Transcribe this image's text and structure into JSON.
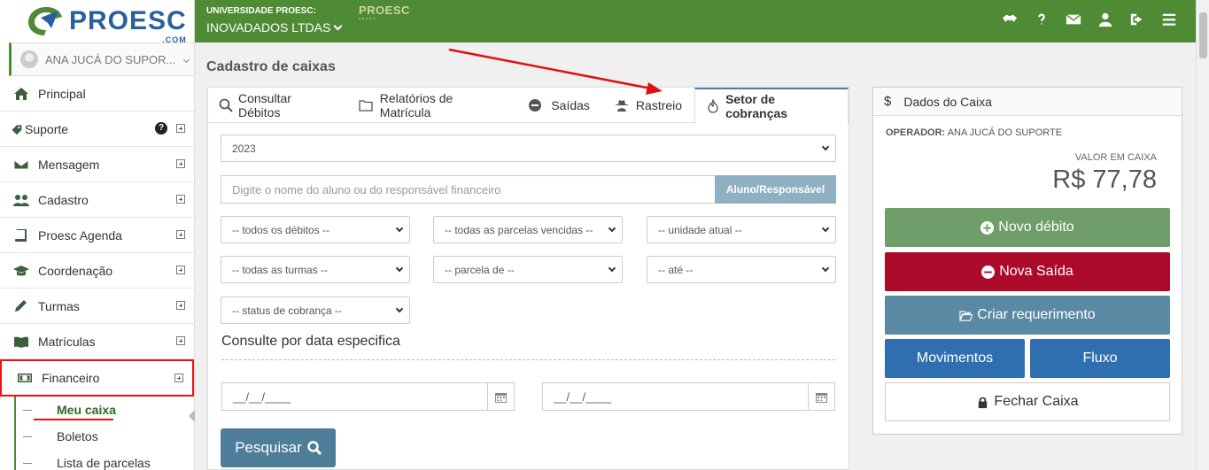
{
  "header": {
    "org": "UNIVERSIDADE PROESC:",
    "unit": "INOVADADOS LTDAS",
    "brand": "PROESC",
    "logo_com": ".COM"
  },
  "sidebar": {
    "user": "ANA JUCÁ DO SUPOR...",
    "items": [
      {
        "label": "Principal"
      },
      {
        "label": "Suporte"
      },
      {
        "label": "Mensagem"
      },
      {
        "label": "Cadastro"
      },
      {
        "label": "Proesc Agenda"
      },
      {
        "label": "Coordenação"
      },
      {
        "label": "Turmas"
      },
      {
        "label": "Matrículas"
      },
      {
        "label": "Financeiro"
      }
    ],
    "sub": [
      "Meu caixa",
      "Boletos",
      "Lista de parcelas"
    ],
    "help_mark": "?"
  },
  "page": {
    "title": "Cadastro de caixas"
  },
  "tabs": [
    "Consultar Débitos",
    "Relatórios de Matrícula",
    "Saídas",
    "Rastreio",
    "Setor de cobranças"
  ],
  "filters": {
    "year": "2023",
    "search_placeholder": "Digite o nome do aluno ou do responsável financeiro",
    "search_button": "Aluno/Responsável",
    "debts": "-- todos os débitos --",
    "installments": "-- todas as parcelas vencidas --",
    "unit": "-- unidade atual --",
    "classes": "-- todas as turmas --",
    "from_parcel": "-- parcela de --",
    "to": "-- até --",
    "status": "-- status de cobrança --",
    "date_section": "Consulte por data especifica",
    "date_from": "__/__/____",
    "date_to": "__/__/____",
    "submit": "Pesquisar"
  },
  "cashbox": {
    "title": "Dados do Caixa",
    "currency_symbol": "$",
    "operator_label": "OPERADOR:",
    "operator": "ANA JUCÁ DO SUPORTE",
    "value_label": "VALOR EM CAIXA",
    "value": "R$ 77,78",
    "btn_new_debit": "Novo débito",
    "btn_new_exit": "Nova Saída",
    "btn_request": "Criar requerimento",
    "btn_moves": "Movimentos",
    "btn_flow": "Fluxo",
    "btn_close": "Fechar Caixa"
  },
  "colors": {
    "header_green": "#4f8a35",
    "new_debit": "#6f9e6a",
    "new_exit": "#ab0a2a",
    "request": "#5a8aa3",
    "blue": "#2f6fb0",
    "annotation_red": "#e11111"
  }
}
